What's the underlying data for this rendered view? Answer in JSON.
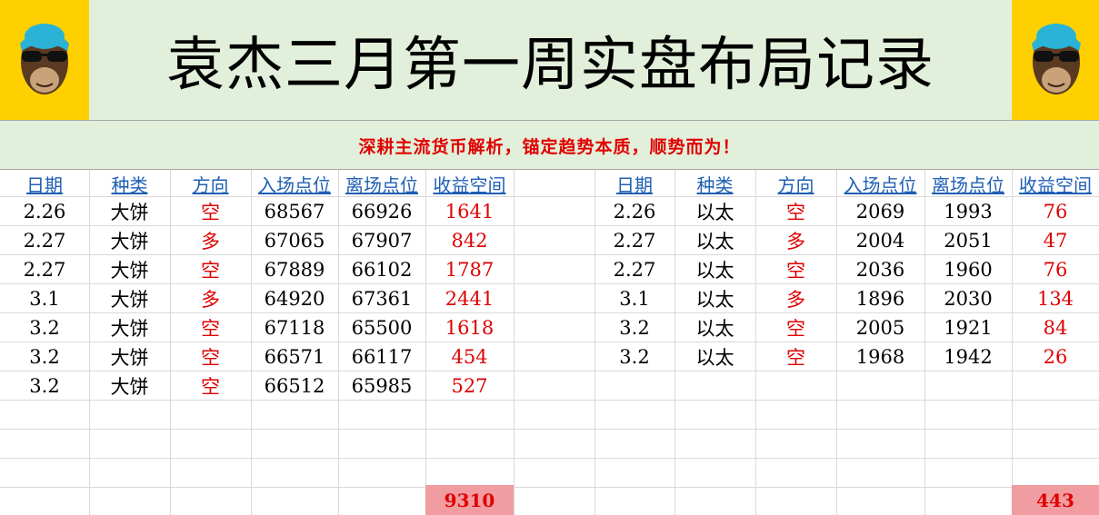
{
  "header": {
    "title": "袁杰三月第一周实盘布局记录",
    "subtitle": "深耕主流货币解析，锚定趋势本质，顺势而为！"
  },
  "columns": [
    "日期",
    "种类",
    "方向",
    "入场点位",
    "离场点位",
    "收益空间"
  ],
  "left_table": {
    "rows": [
      [
        "2.26",
        "大饼",
        "空",
        "68567",
        "66926",
        "1641"
      ],
      [
        "2.27",
        "大饼",
        "多",
        "67065",
        "67907",
        "842"
      ],
      [
        "2.27",
        "大饼",
        "空",
        "67889",
        "66102",
        "1787"
      ],
      [
        "3.1",
        "大饼",
        "多",
        "64920",
        "67361",
        "2441"
      ],
      [
        "3.2",
        "大饼",
        "空",
        "67118",
        "65500",
        "1618"
      ],
      [
        "3.2",
        "大饼",
        "空",
        "66571",
        "66117",
        "454"
      ],
      [
        "3.2",
        "大饼",
        "空",
        "66512",
        "65985",
        "527"
      ]
    ],
    "total": "9310"
  },
  "right_table": {
    "rows": [
      [
        "2.26",
        "以太",
        "空",
        "2069",
        "1993",
        "76"
      ],
      [
        "2.27",
        "以太",
        "多",
        "2004",
        "2051",
        "47"
      ],
      [
        "2.27",
        "以太",
        "空",
        "2036",
        "1960",
        "76"
      ],
      [
        "3.1",
        "以太",
        "多",
        "1896",
        "2030",
        "134"
      ],
      [
        "3.2",
        "以太",
        "空",
        "2005",
        "1921",
        "84"
      ],
      [
        "3.2",
        "以太",
        "空",
        "1968",
        "1942",
        "26"
      ]
    ],
    "total": "443"
  },
  "colors": {
    "header_bg": "#e2efda",
    "logo_bg": "#ffd000",
    "accent_red": "#e00000",
    "header_blue": "#1f5fb4",
    "total_bg": "#f19ca0"
  },
  "icons": [
    "monkey-logo-icon"
  ]
}
